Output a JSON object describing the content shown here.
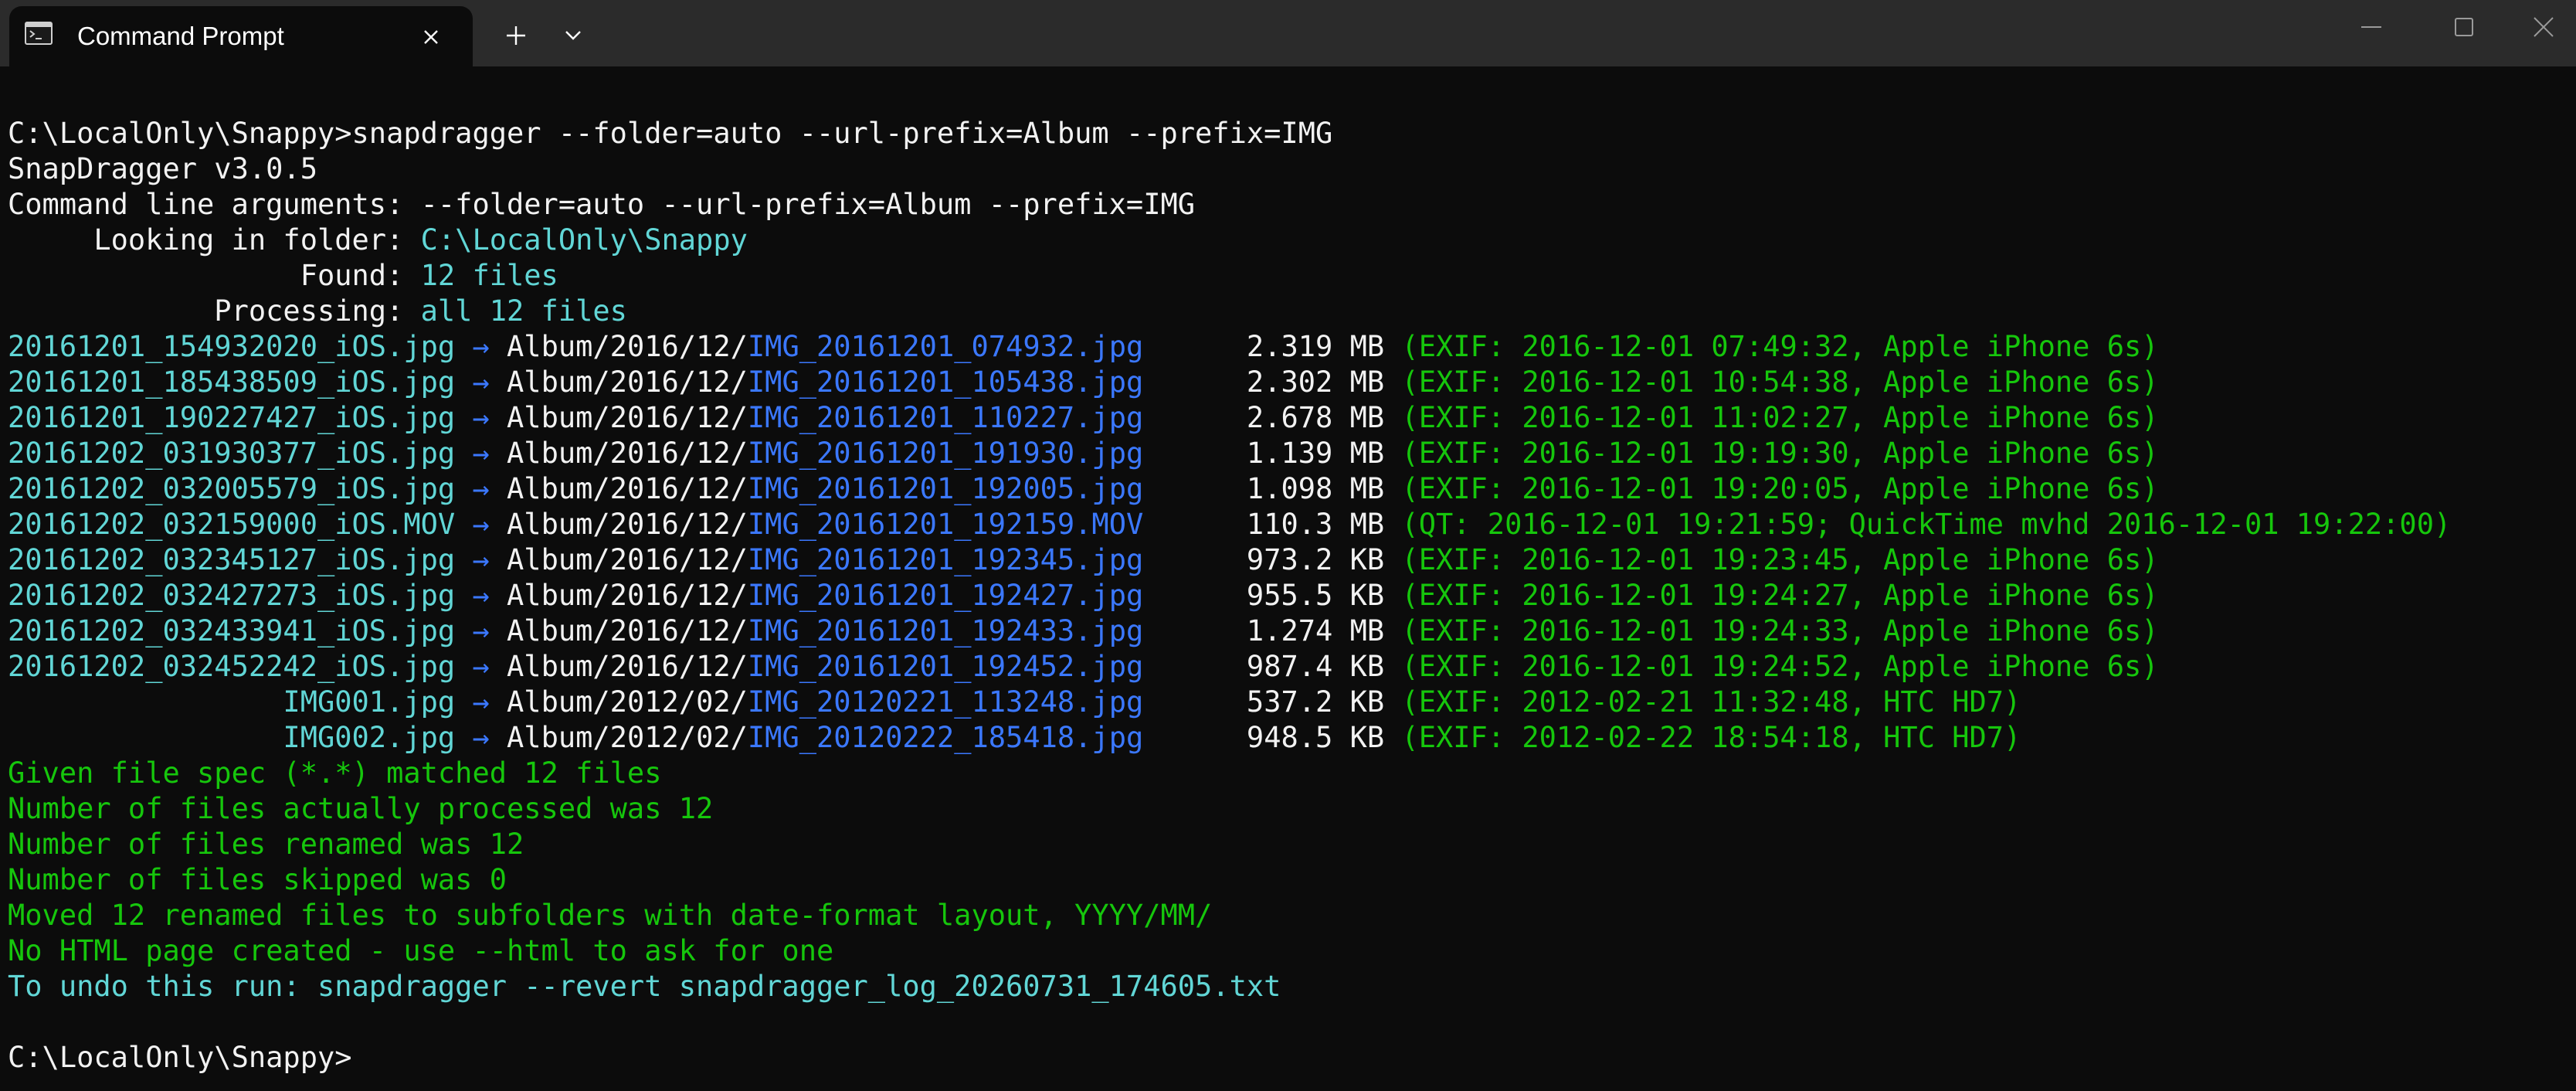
{
  "window": {
    "tab_title": "Command Prompt",
    "icons": {
      "tab": "terminal-icon",
      "tab_close": "close-icon",
      "new_tab": "plus-icon",
      "dropdown": "chevron-down-icon",
      "minimize": "minimize-icon",
      "maximize": "maximize-icon",
      "close": "close-icon"
    }
  },
  "colors": {
    "background": "#0c0c0c",
    "titlebar": "#2b2b2b",
    "text": "#cccccc",
    "bright": "#f2f2f2",
    "cyan": "#61d6d6",
    "blue": "#3b78ff",
    "green": "#16c60c"
  },
  "terminal": {
    "prompt": "C:\\LocalOnly\\Snappy>",
    "command": "snapdragger --folder=auto --url-prefix=Album --prefix=IMG",
    "version": "SnapDragger v3.0.5",
    "args_label": "Command line arguments: ",
    "args_value": "--folder=auto --url-prefix=Album --prefix=IMG",
    "looking_label": "     Looking in folder: ",
    "looking_value": "C:\\LocalOnly\\Snappy",
    "found_label": "                 Found: ",
    "found_value": "12 files",
    "processing_label": "            Processing: ",
    "processing_value": "all 12 files",
    "arrow": "→",
    "files": [
      {
        "src": "20161201_154932020_iOS.jpg",
        "dir": "Album/2016/12/",
        "name": "IMG_20161201_074932.jpg",
        "size": "2.319 MB",
        "info": "(EXIF: 2016-12-01 07:49:32, Apple iPhone 6s)"
      },
      {
        "src": "20161201_185438509_iOS.jpg",
        "dir": "Album/2016/12/",
        "name": "IMG_20161201_105438.jpg",
        "size": "2.302 MB",
        "info": "(EXIF: 2016-12-01 10:54:38, Apple iPhone 6s)"
      },
      {
        "src": "20161201_190227427_iOS.jpg",
        "dir": "Album/2016/12/",
        "name": "IMG_20161201_110227.jpg",
        "size": "2.678 MB",
        "info": "(EXIF: 2016-12-01 11:02:27, Apple iPhone 6s)"
      },
      {
        "src": "20161202_031930377_iOS.jpg",
        "dir": "Album/2016/12/",
        "name": "IMG_20161201_191930.jpg",
        "size": "1.139 MB",
        "info": "(EXIF: 2016-12-01 19:19:30, Apple iPhone 6s)"
      },
      {
        "src": "20161202_032005579_iOS.jpg",
        "dir": "Album/2016/12/",
        "name": "IMG_20161201_192005.jpg",
        "size": "1.098 MB",
        "info": "(EXIF: 2016-12-01 19:20:05, Apple iPhone 6s)"
      },
      {
        "src": "20161202_032159000_iOS.MOV",
        "dir": "Album/2016/12/",
        "name": "IMG_20161201_192159.MOV",
        "size": "110.3 MB",
        "info": "(QT: 2016-12-01 19:21:59; QuickTime mvhd 2016-12-01 19:22:00)"
      },
      {
        "src": "20161202_032345127_iOS.jpg",
        "dir": "Album/2016/12/",
        "name": "IMG_20161201_192345.jpg",
        "size": "973.2 KB",
        "info": "(EXIF: 2016-12-01 19:23:45, Apple iPhone 6s)"
      },
      {
        "src": "20161202_032427273_iOS.jpg",
        "dir": "Album/2016/12/",
        "name": "IMG_20161201_192427.jpg",
        "size": "955.5 KB",
        "info": "(EXIF: 2016-12-01 19:24:27, Apple iPhone 6s)"
      },
      {
        "src": "20161202_032433941_iOS.jpg",
        "dir": "Album/2016/12/",
        "name": "IMG_20161201_192433.jpg",
        "size": "1.274 MB",
        "info": "(EXIF: 2016-12-01 19:24:33, Apple iPhone 6s)"
      },
      {
        "src": "20161202_032452242_iOS.jpg",
        "dir": "Album/2016/12/",
        "name": "IMG_20161201_192452.jpg",
        "size": "987.4 KB",
        "info": "(EXIF: 2016-12-01 19:24:52, Apple iPhone 6s)"
      },
      {
        "src": "IMG001.jpg",
        "dir": "Album/2012/02/",
        "name": "IMG_20120221_113248.jpg",
        "size": "537.2 KB",
        "info": "(EXIF: 2012-02-21 11:32:48, HTC HD7)"
      },
      {
        "src": "IMG002.jpg",
        "dir": "Album/2012/02/",
        "name": "IMG_20120222_185418.jpg",
        "size": "948.5 KB",
        "info": "(EXIF: 2012-02-22 18:54:18, HTC HD7)"
      }
    ],
    "summary": [
      "Given file spec (*.*) matched 12 files",
      "Number of files actually processed was 12",
      "Number of files renamed was 12",
      "Number of files skipped was 0",
      "Moved 12 renamed files to subfolders with date-format layout, YYYY/MM/",
      "No HTML page created - use --html to ask for one"
    ],
    "undo": "To undo this run: snapdragger --revert snapdragger_log_20260731_174605.txt",
    "final_prompt": "C:\\LocalOnly\\Snappy>"
  }
}
